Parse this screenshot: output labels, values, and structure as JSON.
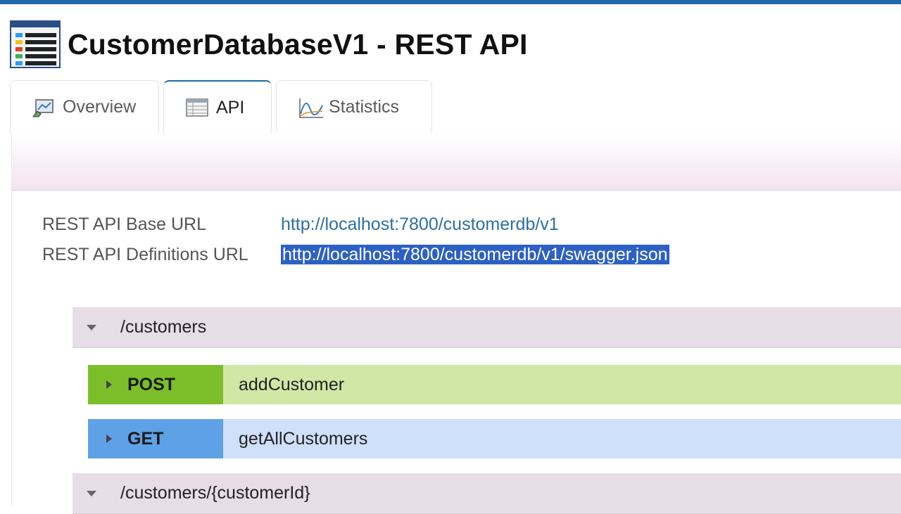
{
  "page": {
    "title": "CustomerDatabaseV1 - REST API"
  },
  "tabs": [
    {
      "label": "Overview",
      "icon": "overview-icon",
      "active": false
    },
    {
      "label": "API",
      "icon": "table-icon",
      "active": true
    },
    {
      "label": "Statistics",
      "icon": "chart-line-icon",
      "active": false
    }
  ],
  "info": {
    "base_url_label": "REST API Base URL",
    "base_url": "http://localhost:7800/customerdb/v1",
    "definitions_url_label": "REST API Definitions URL",
    "definitions_url": "http://localhost:7800/customerdb/v1/swagger.json"
  },
  "resources": [
    {
      "path": "/customers",
      "operations": [
        {
          "method": "POST",
          "summary": "addCustomer",
          "color": "#7cbf2a"
        },
        {
          "method": "GET",
          "summary": "getAllCustomers",
          "color": "#5ea1e6"
        }
      ]
    },
    {
      "path": "/customers/{customerId}",
      "operations": []
    }
  ],
  "colors": {
    "accent": "#1e6aa8",
    "link": "#2d6fa3",
    "selection": "#2d60c4"
  }
}
